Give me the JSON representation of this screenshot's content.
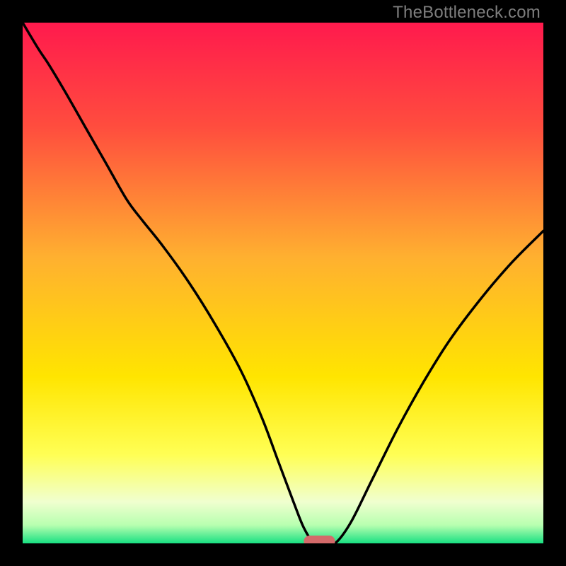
{
  "watermark": "TheBottleneck.com",
  "colors": {
    "bg": "#000000",
    "grad_top": "#ff1a4d",
    "grad_mid_upper": "#ff6a33",
    "grad_mid": "#ffd000",
    "grad_lower": "#ffff66",
    "grad_pale": "#f4ffd4",
    "grad_green": "#18e082",
    "curve": "#000000",
    "marker": "#d46a6a"
  },
  "chart_data": {
    "type": "line",
    "title": "",
    "xlabel": "",
    "ylabel": "",
    "xlim": [
      0,
      100
    ],
    "ylim": [
      0,
      100
    ],
    "x": [
      0,
      3,
      5,
      8,
      12,
      16,
      20,
      23,
      27,
      32,
      37,
      42,
      46,
      49,
      52,
      54,
      56,
      58,
      60,
      63,
      67,
      72,
      77,
      82,
      88,
      94,
      100
    ],
    "values": [
      100,
      95,
      92,
      87,
      80,
      73,
      66,
      62,
      57,
      50,
      42,
      33,
      24,
      16,
      8,
      3,
      0,
      0,
      0,
      4,
      12,
      22,
      31,
      39,
      47,
      54,
      60
    ],
    "marker": {
      "x_start": 54,
      "x_end": 60,
      "y": 0
    }
  }
}
